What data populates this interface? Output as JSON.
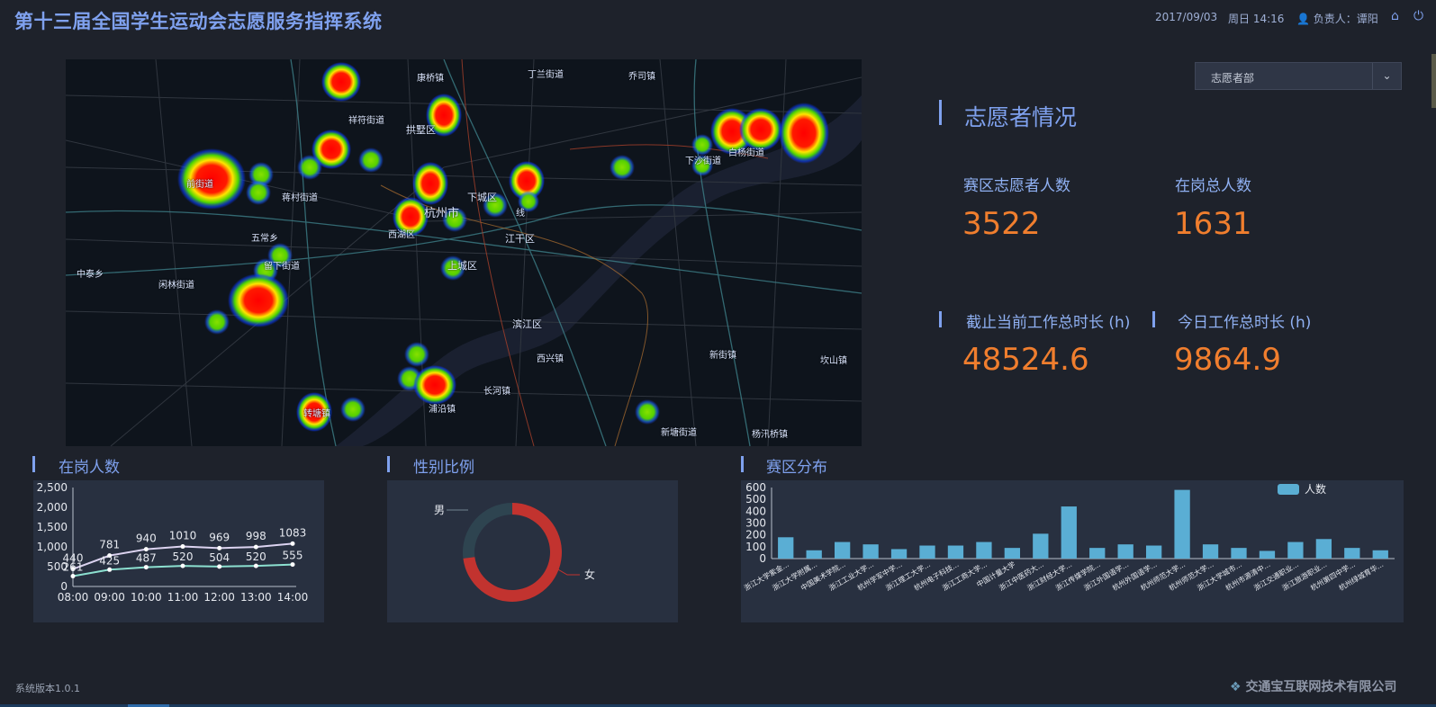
{
  "header": {
    "title": "第十三届全国学生运动会志愿服务指挥系统",
    "date": "2017/09/03",
    "weekday_time": "周日 14:16",
    "owner_label": "负责人：谭阳"
  },
  "map": {
    "labels": [
      "康桥镇",
      "丁兰街道",
      "乔司镇",
      "祥符街道",
      "拱墅区",
      "下沙街道",
      "白杨街道",
      "前街道",
      "蒋村街道",
      "下城区",
      "杭州市",
      "西湖区",
      "江干区",
      "五常乡",
      "留下街道",
      "上城区",
      "中泰乡",
      "闲林街道",
      "滨江区",
      "西兴镇",
      "新街镇",
      "坎山镇",
      "长河镇",
      "浦沿镇",
      "转塘镇",
      "新塘街道",
      "杨汛桥镇",
      "线"
    ]
  },
  "dropdown": {
    "selected": "志愿者部"
  },
  "volunteer": {
    "heading": "志愿者情况",
    "area_label": "赛区志愿者人数",
    "area_value": "3522",
    "onduty_label": "在岗总人数",
    "onduty_value": "1631",
    "total_hours_label": "截止当前工作总时长 (h)",
    "total_hours_value": "48524.6",
    "today_hours_label": "今日工作总时长 (h)",
    "today_hours_value": "9864.9"
  },
  "sections": {
    "onduty": "在岗人数",
    "gender": "性别比例",
    "area": "赛区分布"
  },
  "chart_data": [
    {
      "type": "line",
      "x": [
        "08:00",
        "09:00",
        "10:00",
        "11:00",
        "12:00",
        "13:00",
        "14:00"
      ],
      "series": [
        {
          "values": [
            440,
            781,
            940,
            1010,
            969,
            998,
            1083
          ],
          "color": "#dcd3f0"
        },
        {
          "values": [
            261,
            425,
            487,
            520,
            504,
            520,
            555
          ],
          "color": "#8ce0d0"
        }
      ],
      "ylim": [
        0,
        2500
      ],
      "yticks": [
        "0",
        "500",
        "1,000",
        "1,500",
        "2,000",
        "2,500"
      ],
      "point_labels": [
        "440",
        "781",
        "940",
        "1010",
        "969",
        "998",
        "1083",
        "261",
        "425",
        "487",
        "520",
        "504",
        "520",
        "555"
      ]
    },
    {
      "type": "pie",
      "labels": [
        "男",
        "女"
      ],
      "values": [
        27,
        73
      ],
      "colors": [
        "#2e4450",
        "#c2332f"
      ]
    },
    {
      "type": "bar",
      "legend": "人数",
      "color": "#5aaed4",
      "ylim": [
        0,
        600
      ],
      "yticks": [
        "0",
        "100",
        "200",
        "300",
        "400",
        "500",
        "600"
      ],
      "categories": [
        "浙江大学紫金...",
        "浙江大学附属...",
        "中国美术学院...",
        "浙江工业大学...",
        "杭州学军中学...",
        "浙江理工大学...",
        "杭州电子科技...",
        "浙江工商大学...",
        "中国计量大学",
        "浙江中医药大...",
        "浙江财经大学...",
        "浙江传媒学院...",
        "浙江外国语学...",
        "杭州外国语学...",
        "杭州师范大学...",
        "杭州师范大学...",
        "浙江大学城市...",
        "杭州市源清中...",
        "浙江交通职业...",
        "浙江旅游职业...",
        "杭州第四中学...",
        "杭州绿城育华..."
      ],
      "values": [
        180,
        70,
        140,
        120,
        80,
        110,
        110,
        140,
        90,
        210,
        440,
        90,
        120,
        110,
        580,
        120,
        90,
        65,
        140,
        165,
        90,
        70
      ]
    }
  ],
  "footer": {
    "version": "系统版本1.0.1",
    "company": "交通宝互联网技术有限公司"
  }
}
